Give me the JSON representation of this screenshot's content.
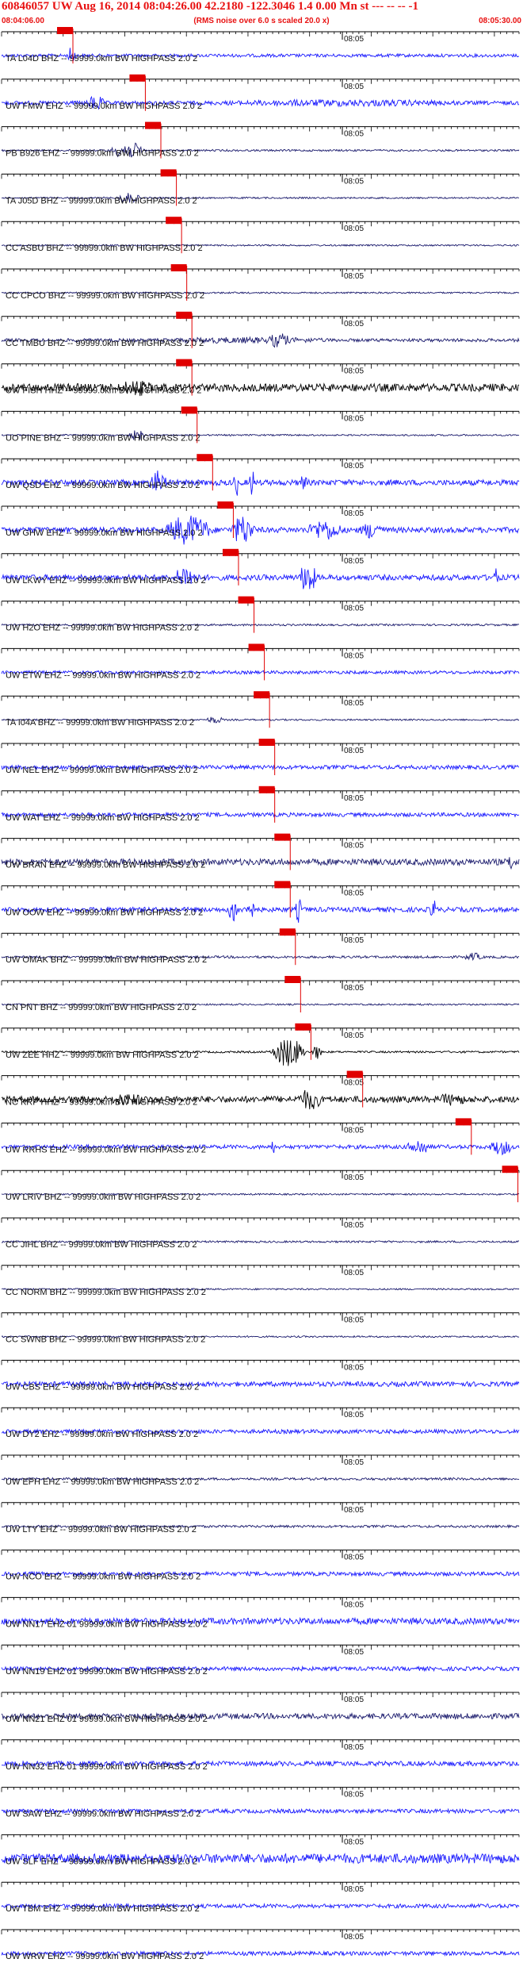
{
  "header": {
    "title": "60846057 UW Aug 16, 2014 08:04:26.00   42.2180 -122.3046  1.4 0.00 Mn st --- -- --   -1",
    "subtitle": "(RMS noise over 6.0 s scaled 20.0 x)",
    "time_start": "08:04:06.00",
    "time_end": "08:05:30.00"
  },
  "minute_marker": "08:05",
  "colors": {
    "header": "#e81010",
    "pick": "#e00000",
    "trace_blue": "#1a1aff",
    "trace_navy": "#1c1c6e",
    "trace_black": "#000000"
  },
  "stations": [
    {
      "label": "TA L04D BHZ -- 99999.0km BW  HIGHPASS  2.0  2",
      "color": "#1a1aff",
      "noise": 2.0,
      "pick": 0.0,
      "bursts": [
        [
          0.13,
          0.015,
          10
        ]
      ]
    },
    {
      "label": "UW FMW EHZ -- 99999.0km BW  HIGHPASS  2.0  2",
      "color": "#1a1aff",
      "noise": 2.5,
      "pick": 0.14,
      "bursts": [
        [
          0.17,
          0.03,
          8
        ],
        [
          0.5,
          0.4,
          2
        ]
      ]
    },
    {
      "label": "PB B926 EHZ -- 99999.0km BW  HIGHPASS  2.0  2",
      "color": "#1c1c6e",
      "noise": 1.2,
      "pick": 0.17,
      "bursts": [
        [
          0.22,
          0.06,
          10
        ]
      ]
    },
    {
      "label": "TA J05D BHZ -- 99999.0km BW  HIGHPASS  2.0  2",
      "color": "#1c1c6e",
      "noise": 1.0,
      "pick": 0.2,
      "bursts": [
        [
          0.23,
          0.04,
          6
        ]
      ]
    },
    {
      "label": "CC ASBU BHZ -- 99999.0km BW  HIGHPASS  2.0  2",
      "color": "#1c1c6e",
      "noise": 1.0,
      "pick": 0.21,
      "bursts": []
    },
    {
      "label": "CC CPCO BHZ -- 99999.0km BW  HIGHPASS  2.0  2",
      "color": "#1c1c6e",
      "noise": 1.0,
      "pick": 0.22,
      "bursts": []
    },
    {
      "label": "CC TMBU BHZ -- 99999.0km BW  HIGHPASS  2.0  2",
      "color": "#1c1c6e",
      "noise": 2.0,
      "pick": 0.23,
      "bursts": [
        [
          0.52,
          0.04,
          8
        ],
        [
          0.35,
          0.3,
          2
        ]
      ]
    },
    {
      "label": "UW FISH HHZ -- 99999.0km BW  HIGHPASS  2.0  2",
      "color": "#000000",
      "noise": 5.0,
      "pick": 0.23,
      "bursts": [
        [
          0.24,
          0.05,
          6
        ]
      ]
    },
    {
      "label": "UO PINE BHZ -- 99999.0km BW  HIGHPASS  2.0  2",
      "color": "#1c1c6e",
      "noise": 1.0,
      "pick": 0.24,
      "bursts": [
        [
          0.25,
          0.03,
          6
        ]
      ]
    },
    {
      "label": "UW QSD EHZ -- 99999.0km BW  HIGHPASS  2.0  2",
      "color": "#1a1aff",
      "noise": 3.5,
      "pick": 0.27,
      "bursts": [
        [
          0.29,
          0.03,
          12
        ],
        [
          0.45,
          0.01,
          14
        ],
        [
          0.48,
          0.01,
          14
        ],
        [
          0.58,
          0.01,
          14
        ]
      ]
    },
    {
      "label": "UW GHW EHZ -- 99999.0km BW  HIGHPASS  2.0  2",
      "color": "#1a1aff",
      "noise": 3.5,
      "pick": 0.31,
      "bursts": [
        [
          0.33,
          0.08,
          16
        ],
        [
          0.45,
          0.04,
          16
        ],
        [
          0.6,
          0.06,
          10
        ],
        [
          0.7,
          0.04,
          8
        ]
      ]
    },
    {
      "label": "UW LKWY EHZ -- 99999.0km BW  HIGHPASS  2.0  2",
      "color": "#1a1aff",
      "noise": 3.5,
      "pick": 0.32,
      "bursts": [
        [
          0.34,
          0.04,
          12
        ],
        [
          0.58,
          0.03,
          18
        ],
        [
          0.95,
          0.01,
          10
        ]
      ]
    },
    {
      "label": "UW H2O EHZ -- 99999.0km BW  HIGHPASS  2.0  2",
      "color": "#1c1c6e",
      "noise": 1.2,
      "pick": 0.35,
      "bursts": []
    },
    {
      "label": "UW ETW EHZ -- 99999.0km BW  HIGHPASS  2.0  2",
      "color": "#1a1aff",
      "noise": 2.0,
      "pick": 0.37,
      "bursts": []
    },
    {
      "label": "TA I04A BHZ -- 99999.0km BW  HIGHPASS  2.0  2",
      "color": "#1c1c6e",
      "noise": 1.0,
      "pick": 0.38,
      "bursts": [
        [
          0.4,
          0.03,
          4
        ]
      ]
    },
    {
      "label": "UW NEL EHZ -- 99999.0km BW  HIGHPASS  2.0  2",
      "color": "#1a1aff",
      "noise": 2.5,
      "pick": 0.39,
      "bursts": []
    },
    {
      "label": "UW WAT EHZ -- 99999.0km BW  HIGHPASS  2.0  2",
      "color": "#1a1aff",
      "noise": 2.5,
      "pick": 0.39,
      "bursts": []
    },
    {
      "label": "UW BRAN EHZ -- 99999.0km BW  HIGHPASS  2.0  2",
      "color": "#1c1c6e",
      "noise": 4.0,
      "pick": 0.42,
      "bursts": [
        [
          0.98,
          0.01,
          8
        ]
      ]
    },
    {
      "label": "UW OOW EHZ -- 99999.0km BW  HIGHPASS  2.0  2",
      "color": "#1a1aff",
      "noise": 3.0,
      "pick": 0.42,
      "bursts": [
        [
          0.44,
          0.02,
          14
        ],
        [
          0.47,
          0.02,
          12
        ],
        [
          0.57,
          0.01,
          14
        ],
        [
          0.83,
          0.01,
          14
        ]
      ]
    },
    {
      "label": "UW OMAK BHZ -- 99999.0km BW  HIGHPASS  2.0  2",
      "color": "#1c1c6e",
      "noise": 1.5,
      "pick": 0.43,
      "bursts": [
        [
          0.9,
          0.03,
          4
        ]
      ]
    },
    {
      "label": "CN PNT BHZ -- 99999.0km BW  HIGHPASS  2.0  2",
      "color": "#1c1c6e",
      "noise": 1.0,
      "pick": 0.44,
      "bursts": []
    },
    {
      "label": "UW ZEE HHZ -- 99999.0km BW  HIGHPASS  2.0  2",
      "color": "#000000",
      "noise": 1.2,
      "pick": 0.46,
      "bursts": [
        [
          0.53,
          0.06,
          18
        ],
        [
          0.6,
          0.02,
          8
        ]
      ]
    },
    {
      "label": "NC KRP HHZ -- 99999.0km BW  HIGHPASS  2.0  2",
      "color": "#000000",
      "noise": 4.0,
      "pick": 0.56,
      "bursts": [
        [
          0.58,
          0.04,
          10
        ],
        [
          0.22,
          0.06,
          4
        ],
        [
          0.85,
          0.05,
          4
        ]
      ]
    },
    {
      "label": "UW RRHS EHZ -- 99999.0km BW  HIGHPASS  2.0  2",
      "color": "#1a1aff",
      "noise": 2.5,
      "pick": 0.77,
      "bursts": [
        [
          0.79,
          0.04,
          8
        ],
        [
          0.95,
          0.04,
          8
        ],
        [
          0.52,
          0.01,
          6
        ]
      ]
    },
    {
      "label": "UW LRIV BHZ -- 99999.0km BW  HIGHPASS  2.0  2",
      "color": "#1c1c6e",
      "noise": 1.0,
      "pick": 0.86,
      "bursts": []
    },
    {
      "label": "CC JIHL BHZ -- 99999.0km BW  HIGHPASS  2.0  2",
      "color": "#1c1c6e",
      "noise": 1.2,
      "pick": null,
      "bursts": []
    },
    {
      "label": "CC NORM BHZ -- 99999.0km BW  HIGHPASS  2.0  2",
      "color": "#1c1c6e",
      "noise": 1.0,
      "pick": null,
      "bursts": []
    },
    {
      "label": "CC SWNB BHZ -- 99999.0km BW  HIGHPASS  2.0  2",
      "color": "#1c1c6e",
      "noise": 1.0,
      "pick": null,
      "bursts": []
    },
    {
      "label": "UW CBS EHZ -- 99999.0km BW  HIGHPASS  2.0  2",
      "color": "#1a1aff",
      "noise": 3.0,
      "pick": null,
      "bursts": []
    },
    {
      "label": "UW DY2 EHZ -- 99999.0km BW  HIGHPASS  2.0  2",
      "color": "#1a1aff",
      "noise": 2.5,
      "pick": null,
      "bursts": []
    },
    {
      "label": "UW EPH EHZ -- 99999.0km BW  HIGHPASS  2.0  2",
      "color": "#1c1c6e",
      "noise": 1.5,
      "pick": null,
      "bursts": []
    },
    {
      "label": "UW LTY EHZ -- 99999.0km BW  HIGHPASS  2.0  2",
      "color": "#1c1c6e",
      "noise": 1.5,
      "pick": null,
      "bursts": []
    },
    {
      "label": "UW NCO EHZ -- 99999.0km BW  HIGHPASS  2.0  2",
      "color": "#1a1aff",
      "noise": 2.5,
      "pick": null,
      "bursts": []
    },
    {
      "label": "UW NN17 EHZ 01 99999.0km BW  HIGHPASS  2.0  2",
      "color": "#1a1aff",
      "noise": 4.0,
      "pick": null,
      "bursts": []
    },
    {
      "label": "UW NN19 EHZ 01 99999.0km BW  HIGHPASS  2.0  2",
      "color": "#1a1aff",
      "noise": 2.5,
      "pick": null,
      "bursts": []
    },
    {
      "label": "UW NN21 EHZ 01 99999.0km BW  HIGHPASS  2.0  2",
      "color": "#1c1c6e",
      "noise": 3.5,
      "pick": null,
      "bursts": []
    },
    {
      "label": "UW NN32 EHZ 01 99999.0km BW  HIGHPASS  2.0  2",
      "color": "#1a1aff",
      "noise": 3.0,
      "pick": null,
      "bursts": []
    },
    {
      "label": "UW SAW EHZ -- 99999.0km BW  HIGHPASS  2.0  2",
      "color": "#1a1aff",
      "noise": 2.5,
      "pick": null,
      "bursts": []
    },
    {
      "label": "UW SLF EHZ -- 99999.0km BW  HIGHPASS  2.0  2",
      "color": "#1a1aff",
      "noise": 6.0,
      "pick": null,
      "bursts": []
    },
    {
      "label": "UW TBM EHZ -- 99999.0km BW  HIGHPASS  2.0  2",
      "color": "#1a1aff",
      "noise": 2.5,
      "pick": null,
      "bursts": []
    },
    {
      "label": "UW WRW EHZ -- 99999.0km BW  HIGHPASS  2.0  2",
      "color": "#1a1aff",
      "noise": 2.5,
      "pick": null,
      "bursts": []
    }
  ]
}
